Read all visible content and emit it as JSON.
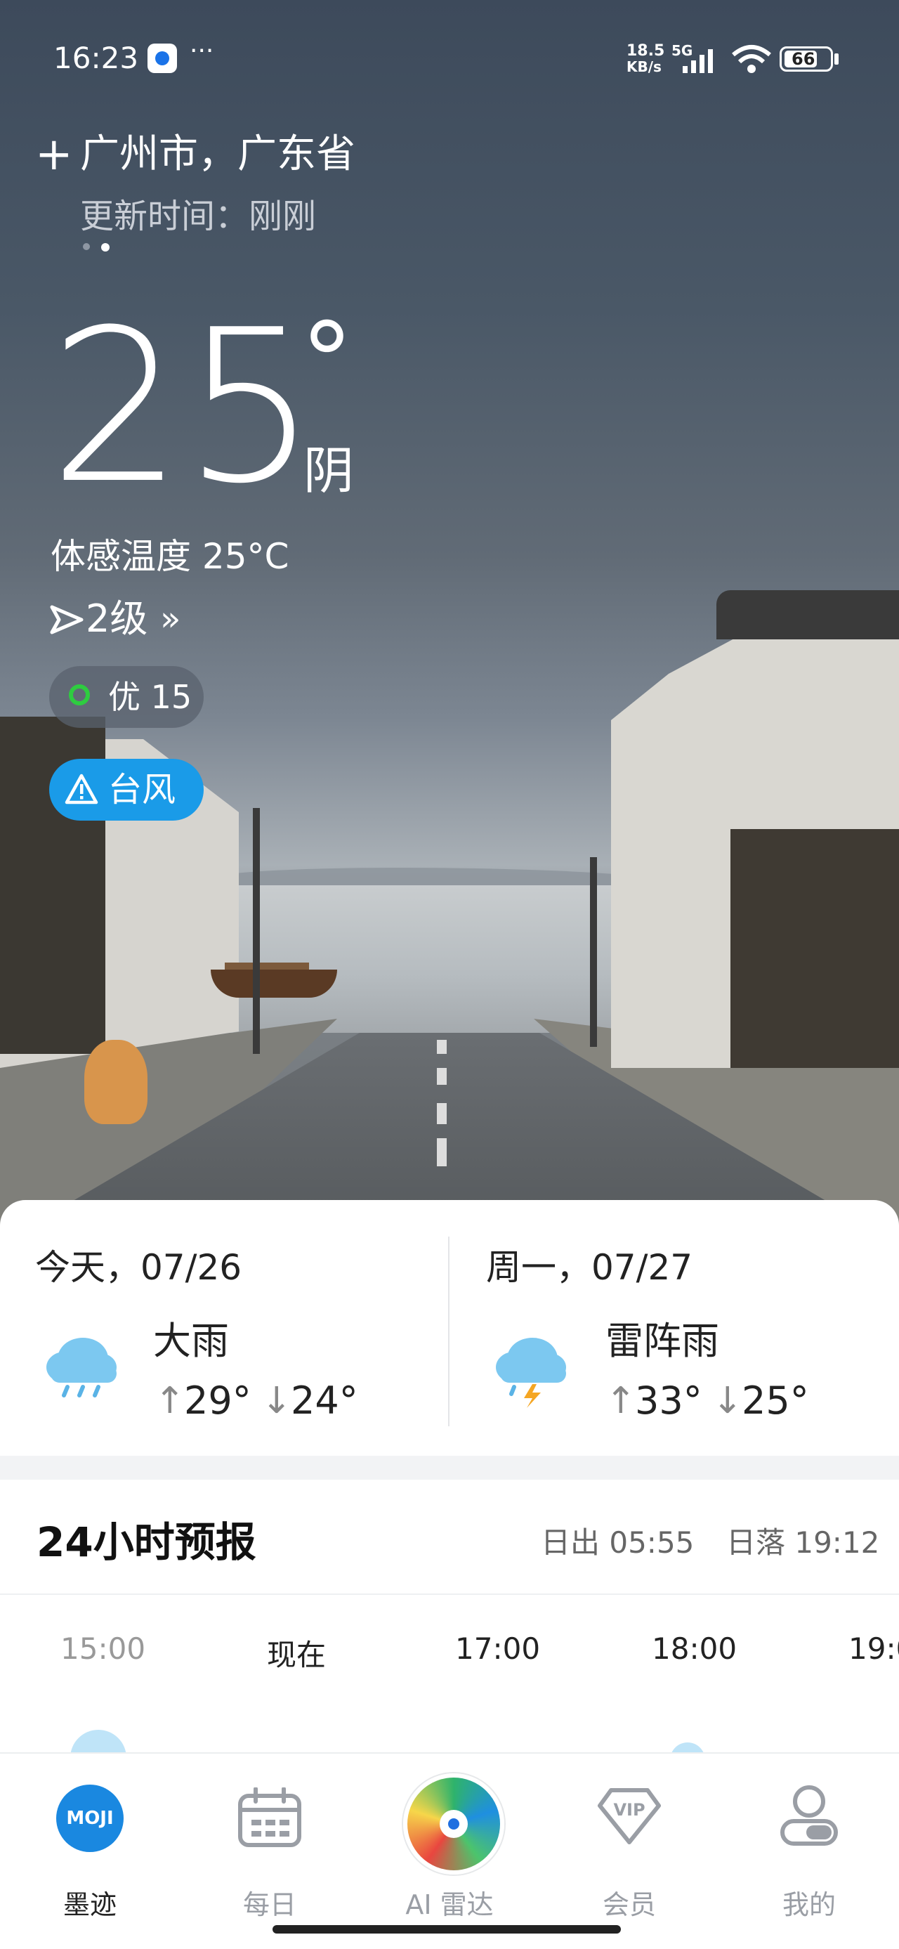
{
  "status_bar": {
    "time": "16:23",
    "more": "···",
    "net_speed_top": "18.5",
    "net_speed_bottom": "KB/s",
    "network": "5G",
    "battery": "66"
  },
  "header": {
    "add_icon": "+",
    "location": "广州市，广东省",
    "update_time": "更新时间：刚刚"
  },
  "current": {
    "temperature": "25",
    "degree": "°",
    "condition": "阴",
    "feels_like": "体感温度 25°C",
    "wind": "2级",
    "aqi": "优 15",
    "alert": "台风"
  },
  "forecast_days": [
    {
      "date": "今天，07/26",
      "condition": "大雨",
      "high": "29°",
      "low": "24°",
      "icon": "heavy-rain-icon"
    },
    {
      "date": "周一，07/27",
      "condition": "雷阵雨",
      "high": "33°",
      "low": "25°",
      "icon": "thunderstorm-icon"
    }
  ],
  "hourly": {
    "title": "24小时预报",
    "sunrise": "日出 05:55",
    "sunset": "日落 19:12",
    "hours": [
      "15:00",
      "现在",
      "17:00",
      "18:00",
      "19:0"
    ]
  },
  "nav": {
    "items": [
      {
        "label": "墨迹",
        "icon": "moji-logo-icon"
      },
      {
        "label": "每日",
        "icon": "calendar-icon"
      },
      {
        "label": "AI 雷达",
        "icon": "radar-icon"
      },
      {
        "label": "会员",
        "icon": "vip-icon"
      },
      {
        "label": "我的",
        "icon": "profile-icon"
      }
    ]
  },
  "colors": {
    "accent": "#1a9be8",
    "aqi_good": "#2ecc40",
    "nav_active": "#1a88e0"
  }
}
